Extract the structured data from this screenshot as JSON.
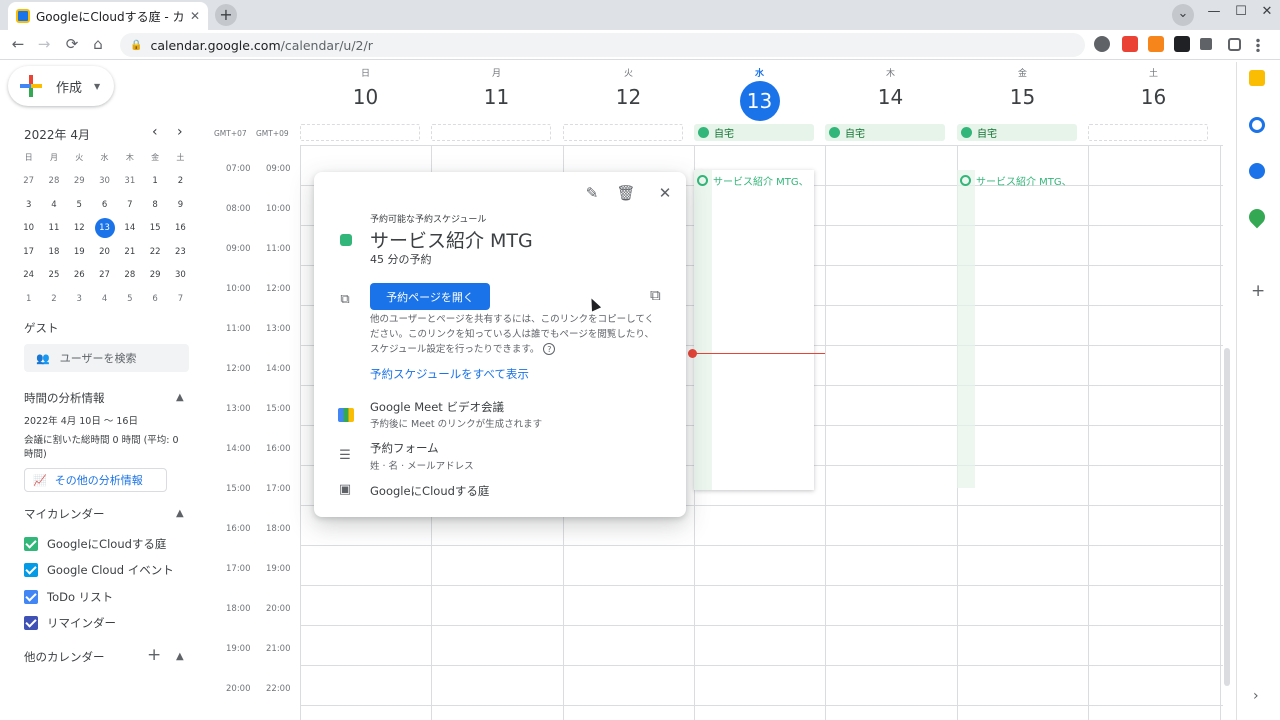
{
  "browser": {
    "tab_title": "GoogleにCloudする庭 - カレン",
    "tab_close": "✕",
    "new_tab": "+",
    "url_host": "calendar.google.com",
    "url_path": "/calendar/u/2/r",
    "back": "←",
    "forward": "→",
    "reload": "⟳",
    "home": "⌂",
    "minimize": "—",
    "maximize": "☐",
    "close": "✕",
    "chevron": "⌄"
  },
  "app": {
    "create_label": "作成",
    "mini_calendar": {
      "title": "2022年 4月",
      "prev": "‹",
      "next": "›",
      "weekdays": [
        "日",
        "月",
        "火",
        "水",
        "木",
        "金",
        "土"
      ],
      "weeks": [
        [
          "27",
          "28",
          "29",
          "30",
          "31",
          "1",
          "2"
        ],
        [
          "3",
          "4",
          "5",
          "6",
          "7",
          "8",
          "9"
        ],
        [
          "10",
          "11",
          "12",
          "13",
          "14",
          "15",
          "16"
        ],
        [
          "17",
          "18",
          "19",
          "20",
          "21",
          "22",
          "23"
        ],
        [
          "24",
          "25",
          "26",
          "27",
          "28",
          "29",
          "30"
        ],
        [
          "1",
          "2",
          "3",
          "4",
          "5",
          "6",
          "7"
        ]
      ],
      "selected": "13"
    },
    "guest": {
      "heading": "ゲスト",
      "search_placeholder": "ユーザーを検索"
    },
    "analytics": {
      "heading": "時間の分析情報",
      "range": "2022年 4月 10日 〜 16日",
      "summary_line1": "会議に割いた総時間 0 時間 (平均: 0",
      "summary_line2": "時間)",
      "more_button": "その他の分析情報"
    },
    "my_calendars": {
      "heading": "マイカレンダー",
      "items": [
        {
          "label": "GoogleにCloudする庭",
          "color": "#33b679"
        },
        {
          "label": "Google Cloud イベント",
          "color": "#039be5"
        },
        {
          "label": "ToDo リスト",
          "color": "#4285f4"
        },
        {
          "label": "リマインダー",
          "color": "#3f51b5"
        }
      ]
    },
    "other_calendars": {
      "heading": "他のカレンダー",
      "add": "+"
    },
    "week": {
      "tz1": "GMT+07",
      "tz2": "GMT+09",
      "days": [
        {
          "name": "日",
          "date": "10"
        },
        {
          "name": "月",
          "date": "11"
        },
        {
          "name": "火",
          "date": "12"
        },
        {
          "name": "水",
          "date": "13"
        },
        {
          "name": "木",
          "date": "14"
        },
        {
          "name": "金",
          "date": "15"
        },
        {
          "name": "土",
          "date": "16"
        }
      ],
      "allday_label": "自宅",
      "times1": [
        "07:00",
        "08:00",
        "09:00",
        "10:00",
        "11:00",
        "12:00",
        "13:00",
        "14:00",
        "15:00",
        "16:00",
        "17:00",
        "18:00",
        "19:00",
        "20:00"
      ],
      "times2": [
        "09:00",
        "10:00",
        "11:00",
        "12:00",
        "13:00",
        "14:00",
        "15:00",
        "16:00",
        "17:00",
        "18:00",
        "19:00",
        "20:00",
        "21:00",
        "22:00"
      ],
      "slot_event_label": "サービス紹介 MTG、"
    },
    "popup": {
      "subtitle": "予約可能な予約スケジュール",
      "title": "サービス紹介 MTG",
      "duration": "45 分の予約",
      "open_button": "予約ページを開く",
      "description": "他のユーザーとページを共有するには、このリンクをコピーしてください。このリンクを知っている人は誰でもページを閲覧したり、スケジュール設定を行ったりできます。",
      "help": "?",
      "view_all": "予約スケジュールをすべて表示",
      "meet_label": "Google Meet ビデオ会議",
      "meet_sub": "予約後に Meet のリンクが生成されます",
      "form_label": "予約フォーム",
      "form_sub": "姓 · 名 · メールアドレス",
      "calendar_label": "GoogleにCloudする庭"
    }
  }
}
